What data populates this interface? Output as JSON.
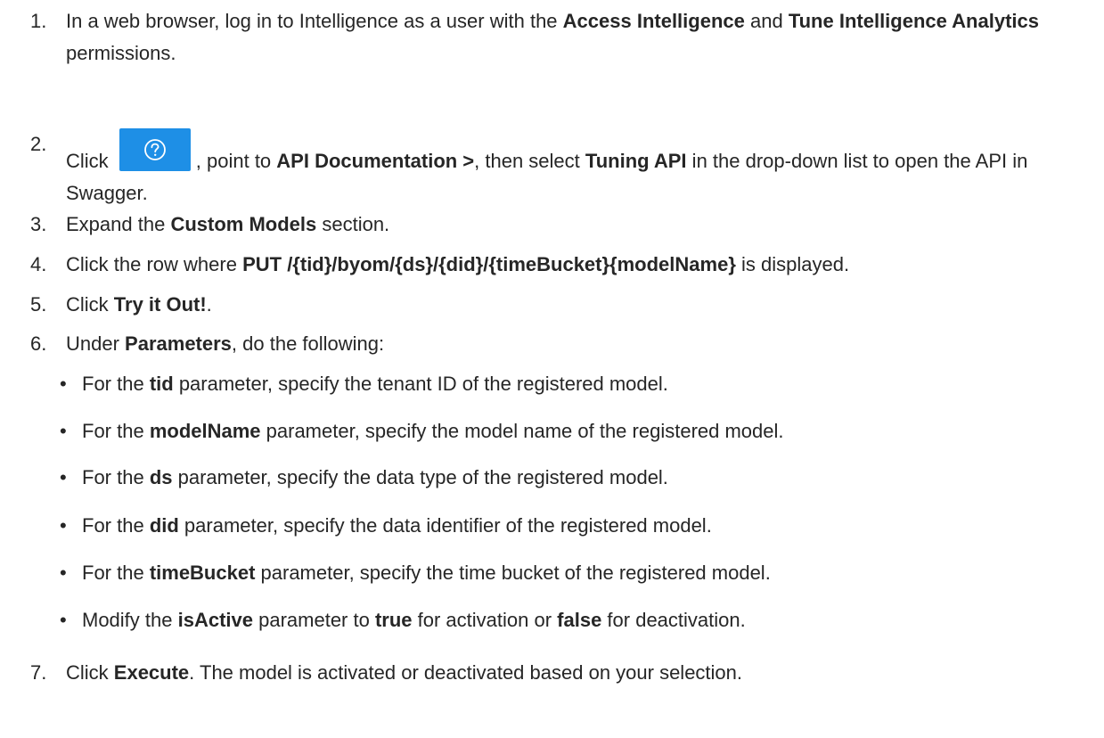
{
  "steps": [
    {
      "num": "1.",
      "parts": [
        {
          "t": "In a web browser, log in to Intelligence as a user with the "
        },
        {
          "t": "Access Intelligence",
          "b": true
        },
        {
          "t": " and "
        },
        {
          "t": "Tune Intelligence Analytics",
          "b": true
        },
        {
          "t": " permissions."
        }
      ]
    },
    {
      "num": "2.",
      "parts": [
        {
          "t": "Click "
        },
        {
          "icon": "help-icon"
        },
        {
          "t": ", point to "
        },
        {
          "t": "API Documentation >",
          "b": true
        },
        {
          "t": ", then select "
        },
        {
          "t": "Tuning API",
          "b": true
        },
        {
          "t": " in the drop-down list to open the API in Swagger."
        }
      ]
    },
    {
      "num": "3.",
      "parts": [
        {
          "t": "Expand the "
        },
        {
          "t": "Custom Models",
          "b": true
        },
        {
          "t": " section."
        }
      ]
    },
    {
      "num": "4.",
      "parts": [
        {
          "t": "Click the row where "
        },
        {
          "t": "PUT /{tid}/byom/{ds}/{did}/{timeBucket}{modelName}",
          "b": true
        },
        {
          "t": " is displayed."
        }
      ]
    },
    {
      "num": "5.",
      "parts": [
        {
          "t": "Click "
        },
        {
          "t": "Try it Out!",
          "b": true
        },
        {
          "t": "."
        }
      ]
    },
    {
      "num": "6.",
      "parts": [
        {
          "t": "Under "
        },
        {
          "t": "Parameters",
          "b": true
        },
        {
          "t": ", do the following:"
        }
      ]
    },
    {
      "num": "7.",
      "parts": [
        {
          "t": "Click "
        },
        {
          "t": "Execute",
          "b": true
        },
        {
          "t": ". The model is activated or deactivated based on your selection."
        }
      ]
    }
  ],
  "bullet_char": "•",
  "bullets": [
    [
      {
        "t": "For the "
      },
      {
        "t": "tid",
        "b": true
      },
      {
        "t": " parameter, specify the tenant ID of the registered model."
      }
    ],
    [
      {
        "t": "For the "
      },
      {
        "t": "modelName",
        "b": true
      },
      {
        "t": " parameter, specify the model name of the registered model."
      }
    ],
    [
      {
        "t": "For the "
      },
      {
        "t": "ds",
        "b": true
      },
      {
        "t": " parameter, specify the data type of the registered model."
      }
    ],
    [
      {
        "t": "For the "
      },
      {
        "t": "did",
        "b": true
      },
      {
        "t": " parameter, specify the data identifier of the registered model."
      }
    ],
    [
      {
        "t": "For the "
      },
      {
        "t": "timeBucket",
        "b": true
      },
      {
        "t": " parameter, specify the time bucket of the registered model."
      }
    ],
    [
      {
        "t": "Modify the "
      },
      {
        "t": "isActive",
        "b": true
      },
      {
        "t": " parameter to "
      },
      {
        "t": "true",
        "b": true
      },
      {
        "t": " for activation or "
      },
      {
        "t": "false",
        "b": true
      },
      {
        "t": " for deactivation."
      }
    ]
  ],
  "colors": {
    "text": "#262626",
    "help_button_bg": "#1e8fe6",
    "help_icon": "#ffffff"
  }
}
